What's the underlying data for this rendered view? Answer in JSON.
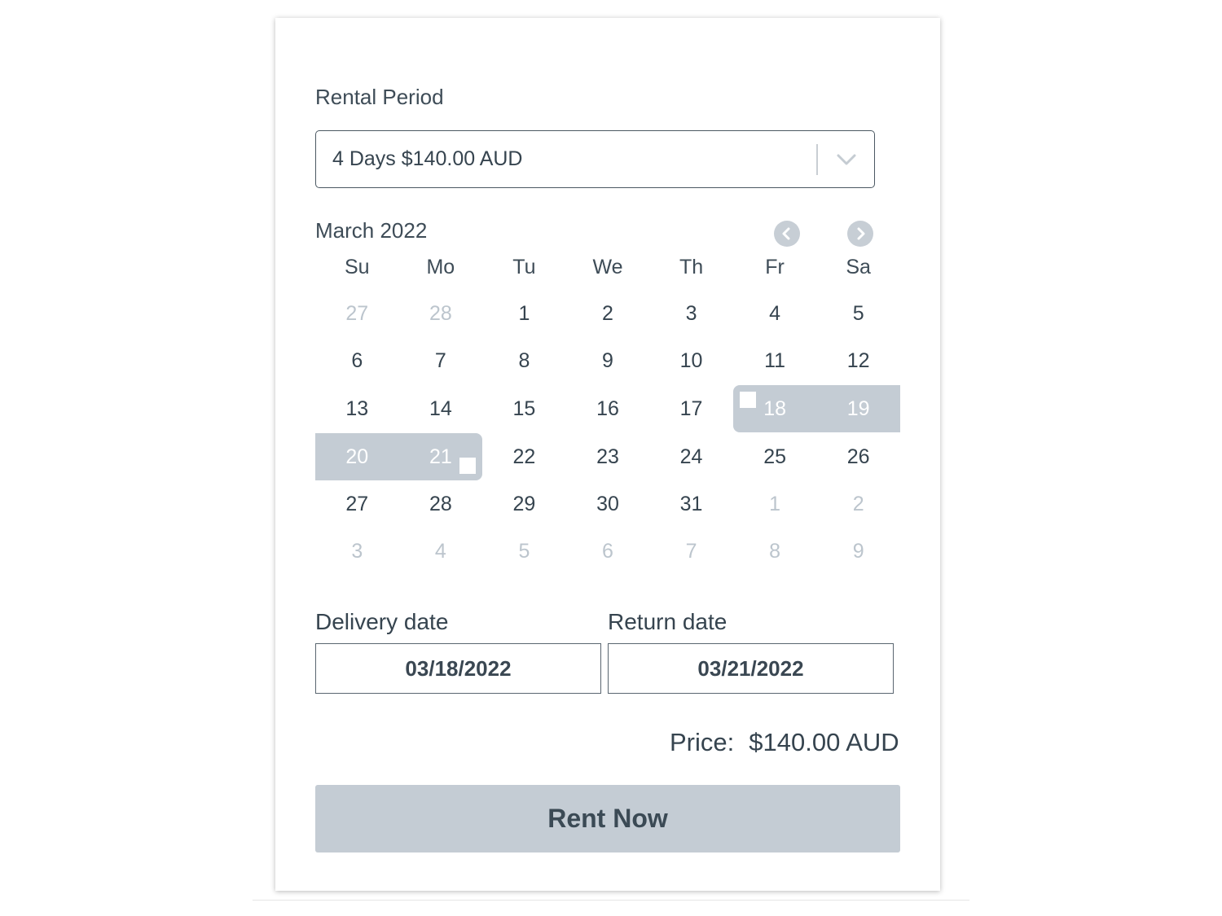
{
  "rental": {
    "label": "Rental Period",
    "selected": "4 Days $140.00 AUD"
  },
  "calendar": {
    "month_title": "March 2022",
    "weekdays": [
      "Su",
      "Mo",
      "Tu",
      "We",
      "Th",
      "Fr",
      "Sa"
    ],
    "weeks": [
      [
        "27",
        "28",
        "1",
        "2",
        "3",
        "4",
        "5"
      ],
      [
        "6",
        "7",
        "8",
        "9",
        "10",
        "11",
        "12"
      ],
      [
        "13",
        "14",
        "15",
        "16",
        "17",
        "18",
        "19"
      ],
      [
        "20",
        "21",
        "22",
        "23",
        "24",
        "25",
        "26"
      ],
      [
        "27",
        "28",
        "29",
        "30",
        "31",
        "1",
        "2"
      ],
      [
        "3",
        "4",
        "5",
        "6",
        "7",
        "8",
        "9"
      ]
    ]
  },
  "delivery": {
    "label": "Delivery date",
    "value": "03/18/2022"
  },
  "return": {
    "label": "Return date",
    "value": "03/21/2022"
  },
  "price": {
    "label": "Price:",
    "value": "$140.00 AUD"
  },
  "rent_button": {
    "label": "Rent Now"
  },
  "colors": {
    "selection": "#c4ccd4",
    "muted_text": "#bcc5cd",
    "text": "#36444f"
  }
}
